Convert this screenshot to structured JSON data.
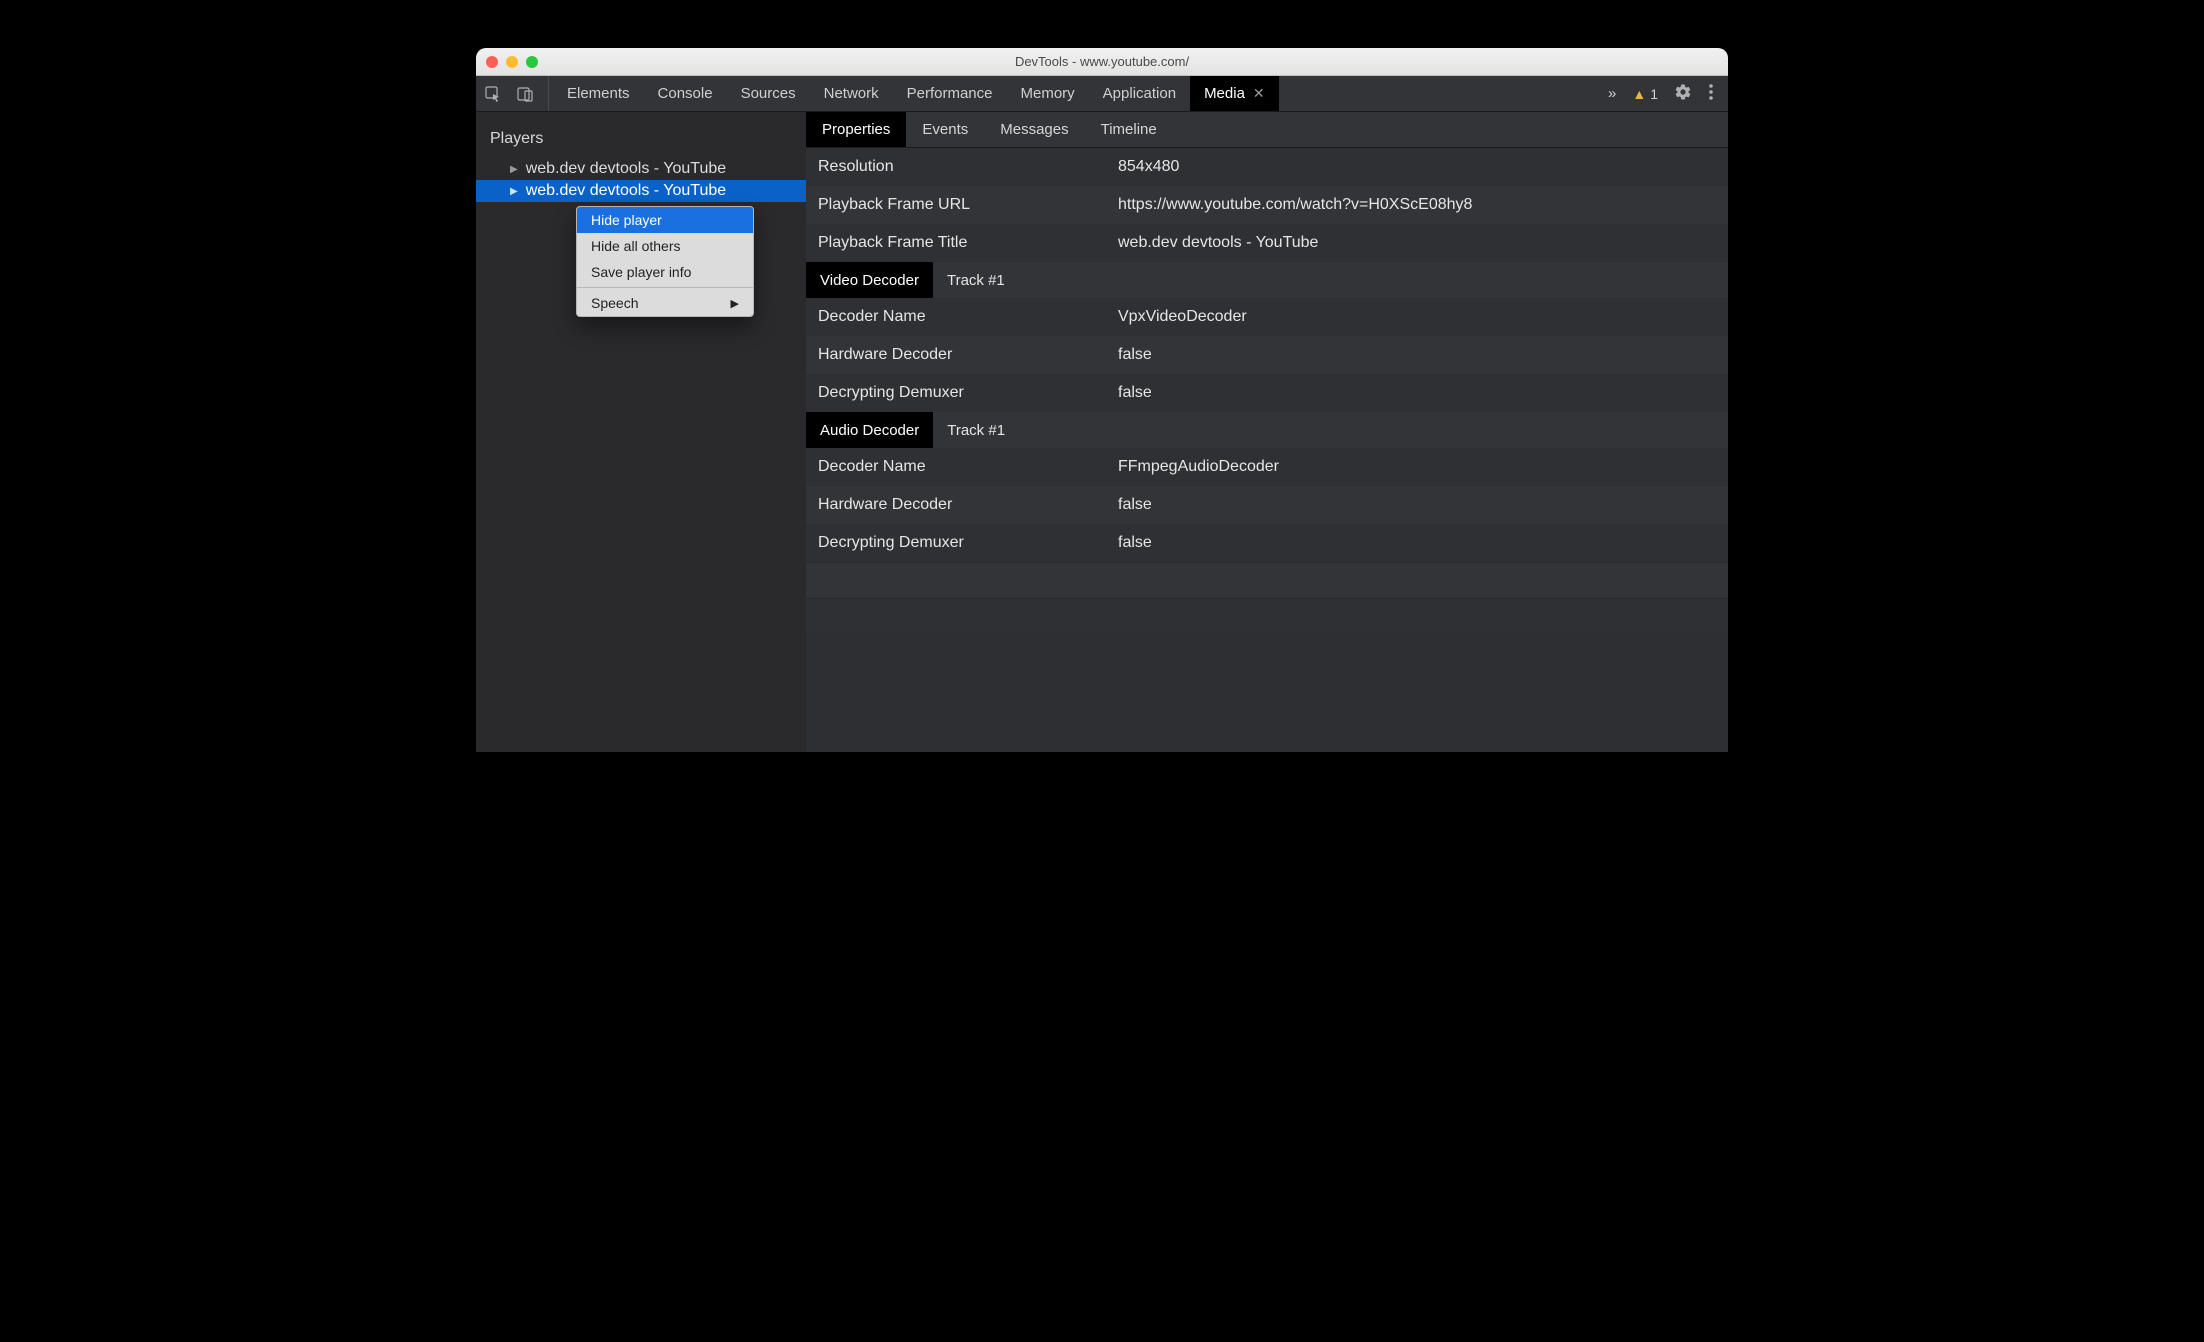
{
  "window": {
    "title": "DevTools - www.youtube.com/"
  },
  "toolbar": {
    "tabs": [
      "Elements",
      "Console",
      "Sources",
      "Network",
      "Performance",
      "Memory",
      "Application",
      "Media"
    ],
    "active_tab_index": 7,
    "warning_count": "1"
  },
  "sidebar": {
    "heading": "Players",
    "items": [
      {
        "label": "web.dev devtools - YouTube",
        "selected": false
      },
      {
        "label": "web.dev devtools - YouTube",
        "selected": true
      }
    ]
  },
  "context_menu": {
    "items": [
      "Hide player",
      "Hide all others",
      "Save player info"
    ],
    "highlight_index": 0,
    "submenu_item": "Speech"
  },
  "subtabs": {
    "items": [
      "Properties",
      "Events",
      "Messages",
      "Timeline"
    ],
    "active_index": 0
  },
  "props": {
    "general": [
      {
        "k": "Resolution",
        "v": "854x480"
      },
      {
        "k": "Playback Frame URL",
        "v": "https://www.youtube.com/watch?v=H0XScE08hy8"
      },
      {
        "k": "Playback Frame Title",
        "v": "web.dev devtools - YouTube"
      }
    ],
    "video_section": {
      "title": "Video Decoder",
      "track": "Track #1"
    },
    "video": [
      {
        "k": "Decoder Name",
        "v": "VpxVideoDecoder"
      },
      {
        "k": "Hardware Decoder",
        "v": "false"
      },
      {
        "k": "Decrypting Demuxer",
        "v": "false"
      }
    ],
    "audio_section": {
      "title": "Audio Decoder",
      "track": "Track #1"
    },
    "audio": [
      {
        "k": "Decoder Name",
        "v": "FFmpegAudioDecoder"
      },
      {
        "k": "Hardware Decoder",
        "v": "false"
      },
      {
        "k": "Decrypting Demuxer",
        "v": "false"
      }
    ]
  }
}
